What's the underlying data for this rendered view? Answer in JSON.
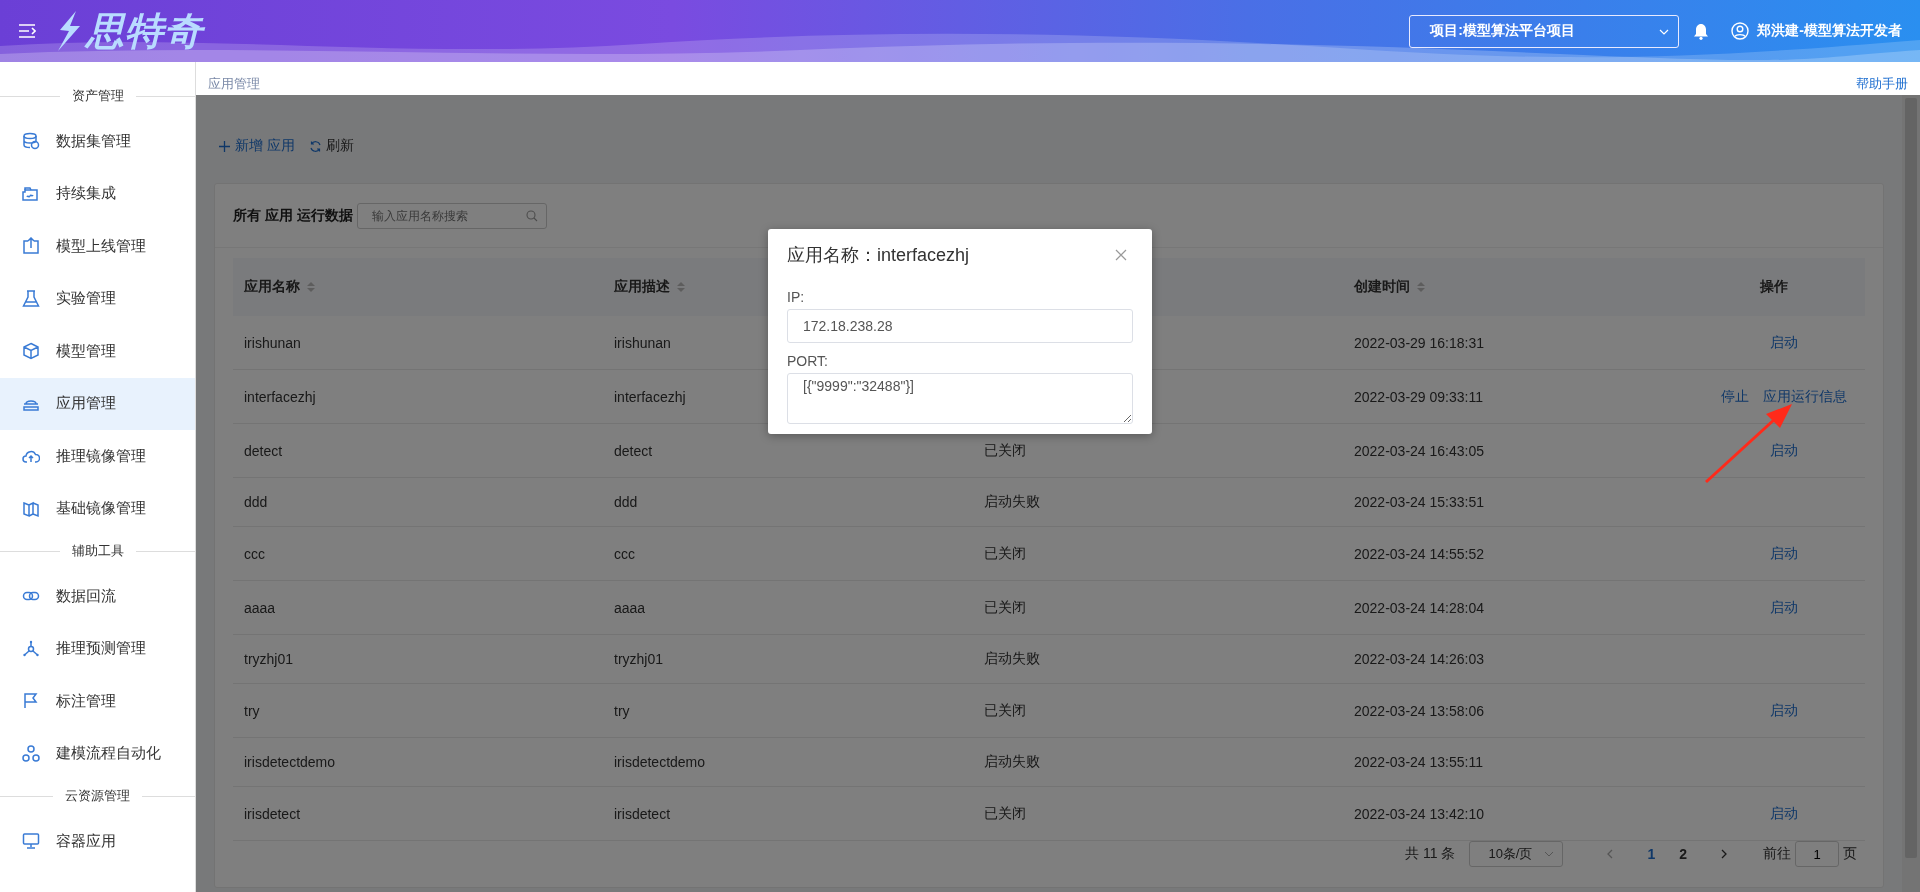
{
  "header": {
    "logo_text": "思特奇",
    "project_select": {
      "value": "项目:模型算法平台项目"
    },
    "user": "郑洪建-模型算法开发者"
  },
  "sidebar": {
    "sections": [
      {
        "title": "资产管理",
        "items": [
          {
            "label": "数据集管理",
            "selected": false
          },
          {
            "label": "持续集成",
            "selected": false
          },
          {
            "label": "模型上线管理",
            "selected": false
          },
          {
            "label": "实验管理",
            "selected": false
          },
          {
            "label": "模型管理",
            "selected": false
          },
          {
            "label": "应用管理",
            "selected": true
          },
          {
            "label": "推理镜像管理",
            "selected": false
          },
          {
            "label": "基础镜像管理",
            "selected": false
          }
        ]
      },
      {
        "title": "辅助工具",
        "items": [
          {
            "label": "数据回流",
            "selected": false
          },
          {
            "label": "推理预测管理",
            "selected": false
          },
          {
            "label": "标注管理",
            "selected": false
          },
          {
            "label": "建模流程自动化",
            "selected": false
          }
        ]
      },
      {
        "title": "云资源管理",
        "items": [
          {
            "label": "容器应用",
            "selected": false
          }
        ]
      }
    ]
  },
  "breadcrumb": "应用管理",
  "help_link": "帮助手册",
  "toolbar": [
    {
      "label": "新增 应用",
      "kind": "add"
    },
    {
      "label": "刷新",
      "kind": "refresh"
    }
  ],
  "filter": {
    "label": "所有 应用 运行数据",
    "search": {
      "placeholder": "输入应用名称搜索"
    }
  },
  "table": {
    "columns": [
      {
        "label": "应用名称",
        "sortable": true
      },
      {
        "label": "应用描述",
        "sortable": true
      },
      {},
      {
        "label": "创建时间",
        "sortable": true
      },
      {
        "label": "操作",
        "sortable": false
      }
    ],
    "rows": [
      {
        "name": "irishunan",
        "description": "irishunan",
        "created": "2022-03-29 16:18:31",
        "actions": [
          "启动"
        ]
      },
      {
        "name": "interfacezhj",
        "description": "interfacezhj",
        "created": "2022-03-29 09:33:11",
        "actions": [
          "停止",
          "应用运行信息"
        ]
      },
      {
        "name": "detect",
        "description": "detect",
        "status": "已关闭",
        "created": "2022-03-24 16:43:05",
        "actions": [
          "启动"
        ]
      },
      {
        "name": "ddd",
        "description": "ddd",
        "status": "启动失败",
        "created": "2022-03-24 15:33:51",
        "actions": []
      },
      {
        "name": "ccc",
        "description": "ccc",
        "status": "已关闭",
        "created": "2022-03-24 14:55:52",
        "actions": [
          "启动"
        ]
      },
      {
        "name": "aaaa",
        "description": "aaaa",
        "status": "已关闭",
        "created": "2022-03-24 14:28:04",
        "actions": [
          "启动"
        ]
      },
      {
        "name": "tryzhj01",
        "description": "tryzhj01",
        "status": "启动失败",
        "created": "2022-03-24 14:26:03",
        "actions": []
      },
      {
        "name": "try",
        "description": "try",
        "status": "已关闭",
        "created": "2022-03-24 13:58:06",
        "actions": [
          "启动"
        ]
      },
      {
        "name": "irisdetectdemo",
        "description": "irisdetectdemo",
        "status": "启动失败",
        "created": "2022-03-24 13:55:11",
        "actions": []
      },
      {
        "name": "irisdetect",
        "description": "irisdetect",
        "status": "已关闭",
        "created": "2022-03-24 13:42:10",
        "actions": [
          "启动"
        ]
      }
    ]
  },
  "pagination": {
    "total": "共 11 条",
    "page_size": "10条/页",
    "pages": [
      {
        "label": "1",
        "selected": true
      },
      {
        "label": "2",
        "selected": false
      }
    ],
    "goto_label": "前往",
    "goto_value": "1",
    "goto_suffix": "页"
  },
  "dialog": {
    "title": "应用名称：interfacezhj",
    "fields": [
      {
        "label": "IP:",
        "value": "172.18.238.28",
        "kind": "input"
      },
      {
        "label": "PORT:",
        "value": "[{\"9999\":\"32488\"}]",
        "kind": "textarea"
      }
    ]
  }
}
